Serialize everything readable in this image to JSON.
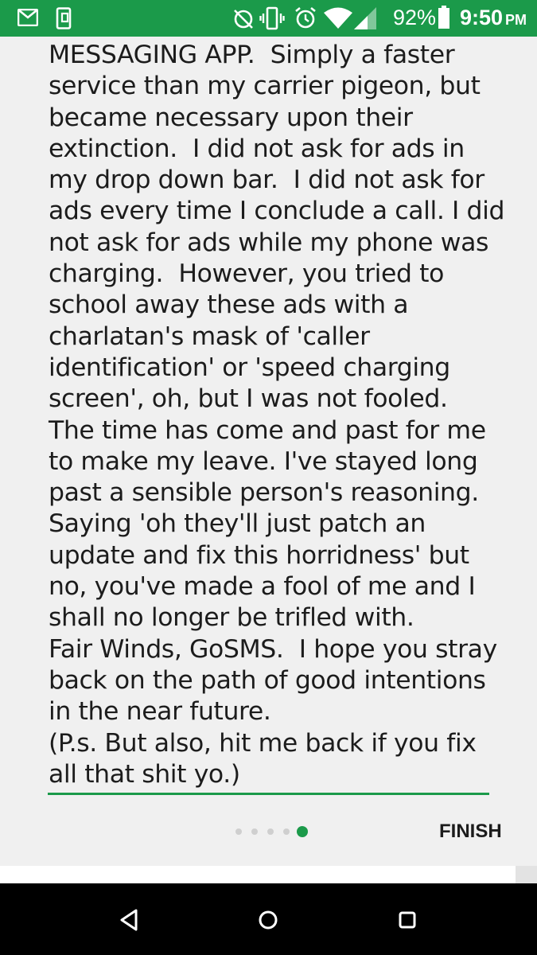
{
  "status_bar": {
    "battery_percent": "92%",
    "time": "9:50",
    "ampm": "PM",
    "icons_left": [
      "gmail-icon",
      "device-screenshot-icon"
    ],
    "icons_right": [
      "sync-off-icon",
      "vibrate-icon",
      "alarm-icon",
      "wifi-icon",
      "cell-signal-icon",
      "battery-icon"
    ]
  },
  "message": {
    "lines": [
      "MESSAGING APP.  Simply a faster",
      "service than my carrier pigeon, but",
      "became necessary upon their",
      "extinction.  I did not ask for ads in",
      "my drop down bar.  I did not ask for",
      "ads every time I conclude a call. I did",
      "not ask for ads while my phone was",
      "charging.  However, you tried to",
      "school away these ads with a",
      "charlatan's mask of 'caller",
      "identification' or 'speed charging",
      "screen', oh, but I was not fooled.",
      "The time has come and past for me",
      "to make my leave. I've stayed long",
      "past a sensible person's reasoning.",
      "Saying 'oh they'll just patch an",
      "update and fix this horridness' but",
      "no, you've made a fool of me and I",
      "shall no longer be trifled with.",
      "Fair Winds, GoSMS.  I hope you stray",
      "back on the path of good intentions",
      "in the near future.",
      "(P.s. But also, hit me back if you fix",
      "all that shit yo.)"
    ]
  },
  "pager": {
    "total": 5,
    "active_index": 4
  },
  "actions": {
    "finish_label": "FINISH"
  },
  "nav_bar": {
    "buttons": [
      "back-icon",
      "home-icon",
      "recents-icon"
    ]
  },
  "colors": {
    "accent": "#1b9a4a",
    "text": "#1c1c1c",
    "background": "#f0f0f0"
  }
}
